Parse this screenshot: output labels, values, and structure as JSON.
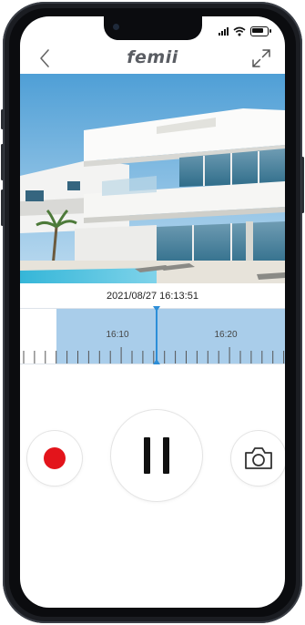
{
  "app": {
    "brand": "femii"
  },
  "video": {
    "timestamp": "2021/08/27 16:13:51"
  },
  "timeline": {
    "labels": [
      "16:10",
      "16:20"
    ]
  },
  "controls": {
    "record_icon": "record-dot-icon",
    "pause_icon": "pause-icon",
    "snapshot_icon": "camera-icon",
    "record_color": "#e3141b"
  },
  "colors": {
    "accent": "#2c8ed8",
    "recorded_segment": "#a9cdea"
  }
}
